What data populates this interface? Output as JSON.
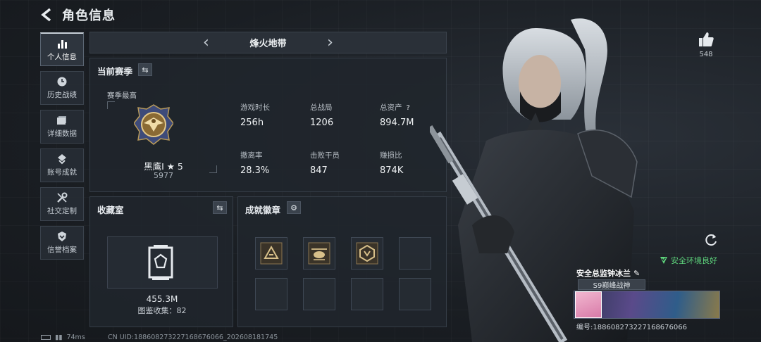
{
  "header": {
    "title": "角色信息"
  },
  "sidebar": {
    "items": [
      {
        "label": "个人信息",
        "icon": "bar-chart-icon",
        "active": true
      },
      {
        "label": "历史战绩",
        "icon": "clock-icon",
        "active": false
      },
      {
        "label": "详细数据",
        "icon": "folder-icon",
        "active": false
      },
      {
        "label": "账号成就",
        "icon": "achievement-icon",
        "active": false
      },
      {
        "label": "社交定制",
        "icon": "wrench-icon",
        "active": false
      },
      {
        "label": "信誉档案",
        "icon": "shield-icon",
        "active": false
      }
    ]
  },
  "map_selector": {
    "name": "烽火地带"
  },
  "season": {
    "title": "当前赛季",
    "best_label": "赛季最高",
    "rank_name": "黑鹰I ★ 5",
    "rank_points": "5977",
    "stats": [
      {
        "label": "游戏时长",
        "value": "256h"
      },
      {
        "label": "总战局",
        "value": "1206"
      },
      {
        "label": "总资产",
        "value": "894.7M",
        "help": "?"
      },
      {
        "label": "撤离率",
        "value": "28.3%"
      },
      {
        "label": "击败干员",
        "value": "847"
      },
      {
        "label": "赚损比",
        "value": "874K"
      }
    ]
  },
  "collection": {
    "title": "收藏室",
    "value": "455.3M",
    "count_text": "图鉴收集：82"
  },
  "badges": {
    "title": "成就徽章"
  },
  "profile": {
    "likes": "548",
    "env_status": "安全环境良好",
    "player_name": "安全总监钟冰兰",
    "season_title": "S9巅峰战神",
    "player_id": "编号:18860827322716867606​6"
  },
  "footer": {
    "ping": "74ms",
    "uid": "CN UID:18860827322716867606​6_202608181745"
  },
  "colors": {
    "accent_green": "#5ed47c",
    "panel_bg": "#20252c"
  }
}
